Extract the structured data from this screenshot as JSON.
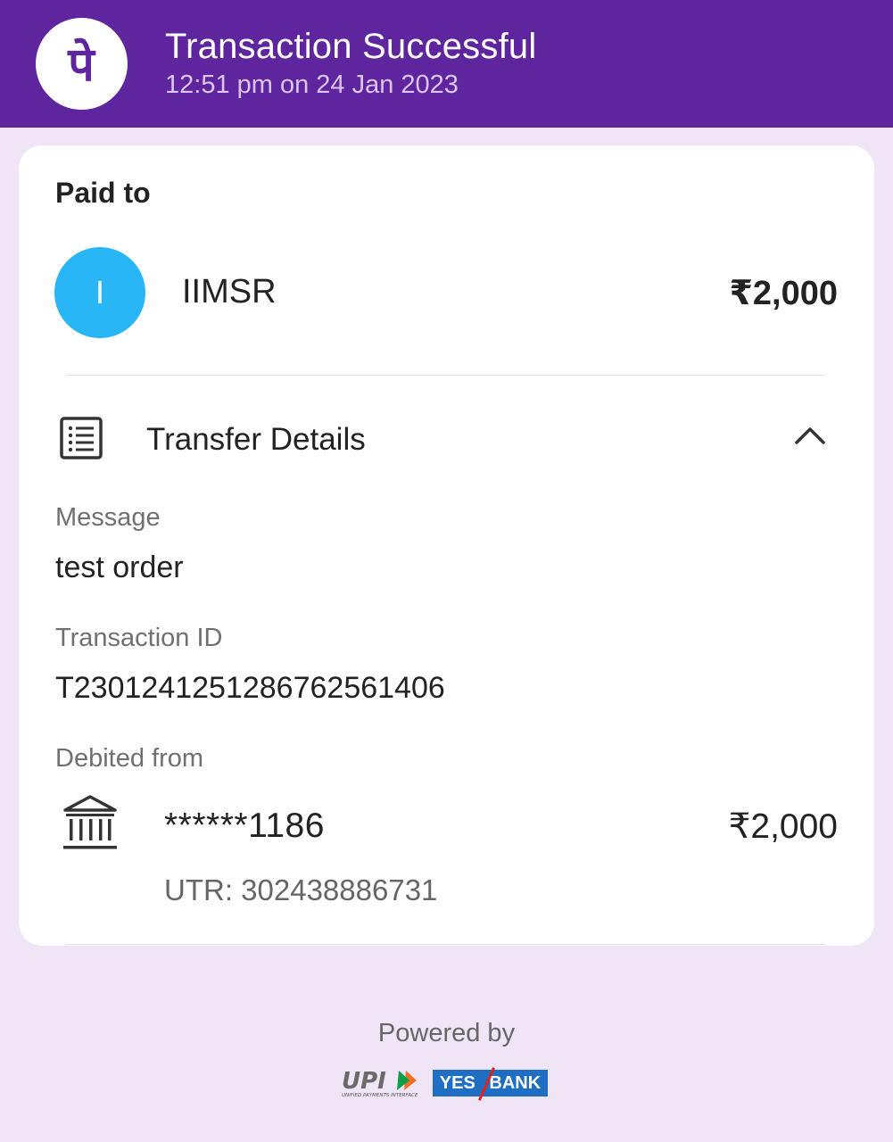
{
  "header": {
    "title": "Transaction Successful",
    "subtitle": "12:51 pm on 24 Jan 2023",
    "logo_icon": "phonepe-logo-icon",
    "logo_glyph": "पे",
    "background_color": "#5f259f"
  },
  "paid_to": {
    "label": "Paid to",
    "avatar_initial": "I",
    "avatar_color": "#29b6f6",
    "name": "IIMSR",
    "amount": "₹2,000"
  },
  "transfer_details": {
    "title": "Transfer Details",
    "icon": "receipt-list-icon",
    "toggle_icon": "chevron-up-icon",
    "message_label": "Message",
    "message_value": "test order",
    "transaction_id_label": "Transaction ID",
    "transaction_id_value": "T2301241251286762561406",
    "debited_from_label": "Debited from",
    "bank_icon": "bank-icon",
    "account": "******1186",
    "debit_amount": "₹2,000",
    "utr": "UTR: 302438886731"
  },
  "footer": {
    "powered_by": "Powered by",
    "upi_logo_text": "UPI",
    "upi_tagline": "UNIFIED PAYMENTS INTERFACE",
    "bank_logo_left": "YES",
    "bank_logo_right": "BANK"
  }
}
